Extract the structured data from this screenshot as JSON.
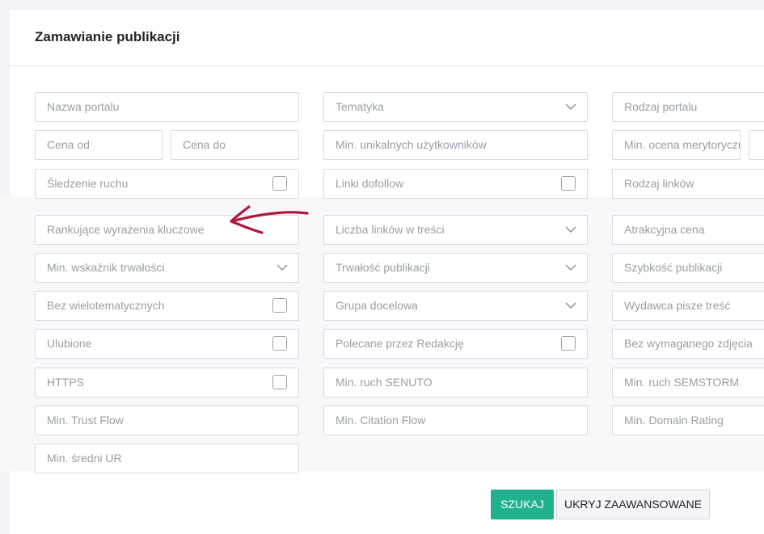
{
  "page": {
    "title": "Zamawianie publikacji"
  },
  "filters": {
    "portal_name": "Nazwa portalu",
    "topic": "Tematyka",
    "portal_type": "Rodzaj portalu",
    "price_from": "Cena od",
    "price_to": "Cena do",
    "min_unique_users": "Min. unikalnych użytkowników",
    "min_merit_rating": "Min. ocena merytoryczna",
    "traffic_tracking": "Śledzenie ruchu",
    "dofollow_links": "Linki dofollow",
    "link_type": "Rodzaj linków",
    "ranking_keywords": "Rankujące wyrażenia kluczowe",
    "links_in_content": "Liczba linków w treści",
    "attractive_price": "Atrakcyjna cena",
    "min_durability": "Min. wskaźnik trwałości",
    "publication_durability": "Trwałość publikacji",
    "publication_speed": "Szybkość publikacji",
    "no_multitopic": "Bez wielotematycznych",
    "target_group": "Grupa docelowa",
    "publisher_writes": "Wydawca pisze treść",
    "favorites": "Ulubione",
    "editor_recommended": "Polecane przez Redakcję",
    "no_photo_required": "Bez wymaganego zdjęcia",
    "https": "HTTPS",
    "min_senuto": "Min. ruch SENUTO",
    "min_semstorm": "Min. ruch SEMSTORM",
    "min_trust_flow": "Min. Trust Flow",
    "min_citation_flow": "Min. Citation Flow",
    "min_domain_rating": "Min. Domain Rating",
    "min_avg_ur": "Min. średni UR"
  },
  "buttons": {
    "search": "SZUKAJ",
    "hide_advanced": "UKRYJ ZAAWANSOWANE"
  },
  "colors": {
    "accent": "#20b28f",
    "arrow": "#b0193f",
    "placeholder": "#999ea6",
    "border": "#d9dbe1"
  }
}
